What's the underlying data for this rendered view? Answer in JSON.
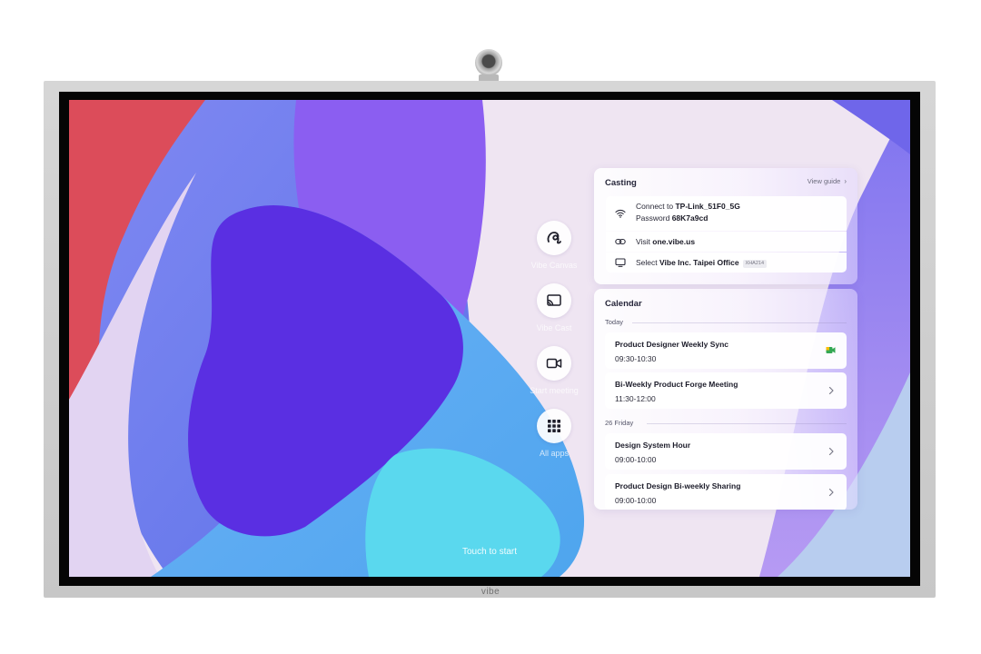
{
  "device": {
    "brand": "vibe"
  },
  "dock": [
    {
      "label": "Vibe Canvas",
      "icon": "vibe-canvas-icon"
    },
    {
      "label": "Vibe Cast",
      "icon": "cast-icon"
    },
    {
      "label": "Start meeting",
      "icon": "video-camera-icon"
    },
    {
      "label": "All apps",
      "icon": "grid-apps-icon"
    }
  ],
  "touch_to_start": "Touch to start",
  "casting": {
    "title": "Casting",
    "view_guide": "View guide",
    "wifi": {
      "connect_prefix": "Connect to ",
      "network": "TP-Link_51F0_5G",
      "password_prefix": "Password ",
      "password": "68K7a9cd",
      "icon": "wifi-icon"
    },
    "visit": {
      "prefix": "Visit ",
      "url": "one.vibe.us",
      "icon": "link-icon"
    },
    "select": {
      "prefix": "Select ",
      "device": "Vibe Inc. Taipei Office",
      "code": "XHA214",
      "icon": "monitor-icon"
    }
  },
  "calendar": {
    "title": "Calendar",
    "sections": [
      {
        "label": "Today",
        "events": [
          {
            "title": "Product Designer Weekly Sync",
            "time": "09:30-10:30",
            "action": "google-meet-icon"
          },
          {
            "title": "Bi-Weekly Product Forge Meeting",
            "time": "11:30-12:00",
            "action": "chevron-right-icon"
          }
        ]
      },
      {
        "label": "26 Friday",
        "events": [
          {
            "title": "Design System Hour",
            "time": "09:00-10:00",
            "action": "chevron-right-icon"
          },
          {
            "title": "Product Design Bi-weekly Sharing",
            "time": "09:00-10:00",
            "action": "chevron-right-icon"
          }
        ]
      }
    ]
  },
  "colors": {
    "accent_violet": "#5a2ee0",
    "wallpaper_blue": "#5f9ff0",
    "wallpaper_cyan": "#5ce0ef",
    "wallpaper_red": "#dd4a58",
    "google_meet_green": "#34a853",
    "google_meet_yellow": "#fbbc04"
  }
}
